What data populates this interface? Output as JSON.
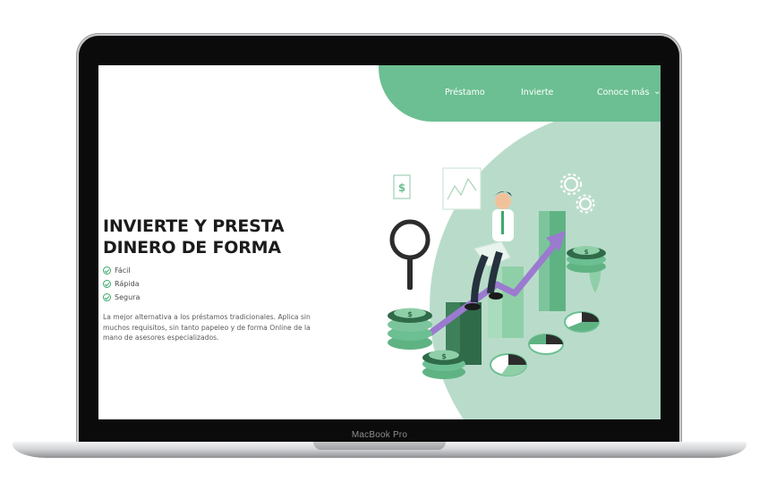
{
  "device": {
    "model_label": "MacBook Pro"
  },
  "nav": {
    "items": [
      {
        "label": "Préstamo"
      },
      {
        "label": "Invierte"
      },
      {
        "label": "Conoce más"
      }
    ]
  },
  "hero": {
    "title_line1": "INVIERTE Y PRESTA",
    "title_line2": "DINERO DE FORMA",
    "features": [
      {
        "label": "Fácil",
        "icon": "check-circle-icon"
      },
      {
        "label": "Rápida",
        "icon": "check-circle-icon"
      },
      {
        "label": "Segura",
        "icon": "check-circle-icon"
      }
    ],
    "description": "La mejor alternativa a los préstamos tradicionales. Aplica sin muchos requisitos, sin tanto papeleo y de forma Online de la mano de asesores especializados."
  },
  "colors": {
    "accent": "#6cbf92",
    "accent_light": "#b9dcca",
    "check": "#3ea86c",
    "title": "#1b1b1b"
  }
}
